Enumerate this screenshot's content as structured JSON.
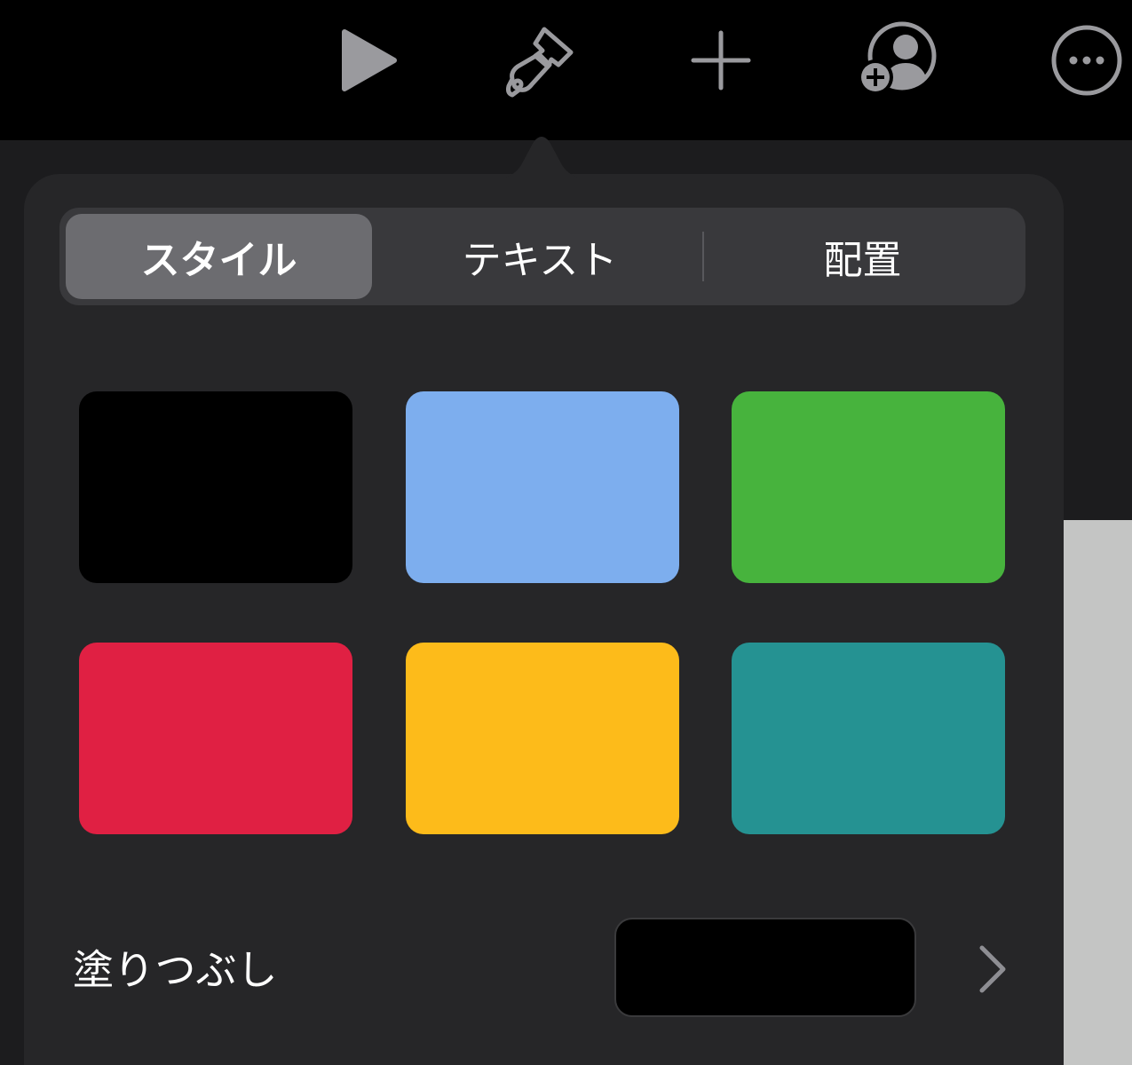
{
  "toolbar": {
    "icons": [
      "play-icon",
      "paintbrush-icon",
      "plus-icon",
      "add-collaborator-icon",
      "more-icon"
    ]
  },
  "inspector": {
    "tabs": [
      {
        "label": "スタイル",
        "selected": true
      },
      {
        "label": "テキスト",
        "selected": false
      },
      {
        "label": "配置",
        "selected": false
      }
    ],
    "swatches": [
      {
        "name": "black",
        "color": "#000000"
      },
      {
        "name": "light-blue",
        "color": "#7daeee"
      },
      {
        "name": "green",
        "color": "#47b33d"
      },
      {
        "name": "red",
        "color": "#e02043"
      },
      {
        "name": "yellow",
        "color": "#fdbb1a"
      },
      {
        "name": "teal",
        "color": "#259292"
      }
    ],
    "fill": {
      "label": "塗りつぶし",
      "color": "#000000"
    }
  },
  "colors": {
    "toolbar_bg": "#000000",
    "popover_bg": "#262628",
    "segment_bg": "#39393c",
    "segment_selected": "#6c6c70",
    "icon_color": "#9a9a9e"
  }
}
